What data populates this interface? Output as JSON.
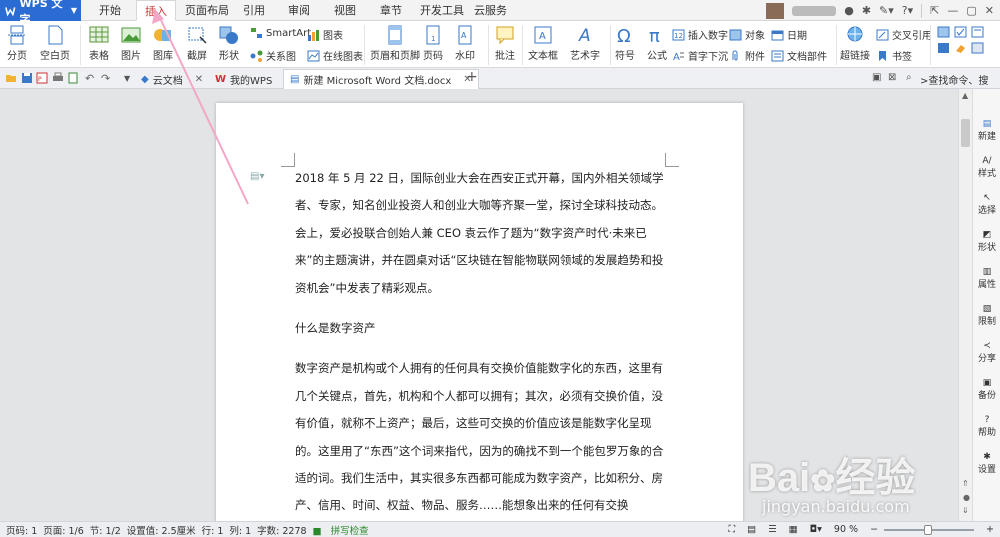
{
  "app": {
    "logo": "WPS 文字"
  },
  "menu": {
    "tabs": [
      "开始",
      "插入",
      "页面布局",
      "引用",
      "审阅",
      "视图",
      "章节",
      "开发工具",
      "云服务"
    ],
    "active": "插入"
  },
  "ribbon": {
    "page_break": "分页",
    "blank_page": "空白页",
    "table": "表格",
    "picture": "图片",
    "gallery": "图库",
    "screenshot": "截屏",
    "shape": "形状",
    "smartart": "SmartArt",
    "relation": "关系图",
    "chart": "图表",
    "online_chart": "在线图表",
    "header_footer": "页眉和页脚",
    "page_num": "页码",
    "watermark": "水印",
    "comment": "批注",
    "textbox": "文本框",
    "wordart": "艺术字",
    "symbol": "符号",
    "formula": "公式",
    "insert_number": "插入数字",
    "object": "对象",
    "date": "日期",
    "dropcap": "首字下沉",
    "attachment": "附件",
    "doc_parts": "文档部件",
    "hyperlink": "超链接",
    "cross_ref": "交叉引用",
    "bookmark": "书签"
  },
  "tabbar": {
    "tabs": [
      {
        "label": "云文档"
      },
      {
        "label": "我的WPS"
      },
      {
        "label": "新建 Microsoft Word 文档.docx"
      }
    ],
    "add": "+",
    "search": ">查找命令、搜索..."
  },
  "document": {
    "paragraphs": [
      "2018 年 5 月 22 日，国际创业大会在西安正式开幕，国内外相关领域学者、专家，知名创业投资人和创业大咖等齐聚一堂，探讨全球科技动态。会上，爱必投联合创始人兼 CEO 袁云作了题为“数字资产时代·未来已来”的主题演讲，并在圆桌对话“区块链在智能物联网领域的发展趋势和投资机会”中发表了精彩观点。",
      "什么是数字资产",
      "数字资产是机构或个人拥有的任何具有交换价值能数字化的东西，这里有几个关键点，首先，机构和个人都可以拥有；其次，必须有交换价值，没有价值，就称不上资产；最后，这些可交换的价值应该是能数字化呈现的。这里用了“东西”这个词来指代，因为的确找不到一个能包罗万象的合适的词。我们生活中，其实很多东西都可能成为数字资产，比如积分、房产、信用、时间、权益、物品、服务……能想象出来的任何有交换"
    ]
  },
  "right_panel": [
    "新建",
    "样式",
    "选择",
    "形状",
    "属性",
    "限制",
    "分享",
    "备份",
    "帮助",
    "设置"
  ],
  "status": {
    "page_num": "页码: 1",
    "pages": "页面: 1/6",
    "section": "节: 1/2",
    "setting": "设置值: 2.5厘米",
    "row": "行: 1",
    "col": "列: 1",
    "words": "字数: 2278",
    "spell": "拼写检查",
    "zoom": "90 %"
  },
  "watermark": {
    "brand": "Bai",
    "brand2": "经验",
    "url": "jingyan.baidu.com"
  },
  "colors": {
    "logo_bg": "#2a6bd4",
    "active_tab_text": "#cc3333",
    "annotation": "#f0a0c0"
  }
}
